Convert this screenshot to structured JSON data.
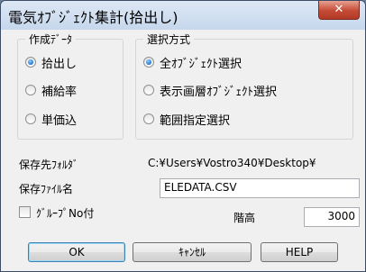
{
  "window": {
    "title": "電気ｵﾌﾞｼﾞｪｸﾄ集計(拾出し)",
    "close_symbol": "✕"
  },
  "data_group": {
    "legend": "作成ﾃﾞｰﾀ",
    "options": [
      {
        "label": "拾出し",
        "selected": true
      },
      {
        "label": "補給率",
        "selected": false
      },
      {
        "label": "単価込",
        "selected": false
      }
    ]
  },
  "method_group": {
    "legend": "選択方式",
    "options": [
      {
        "label": "全ｵﾌﾞｼﾞｪｸﾄ選択",
        "selected": true
      },
      {
        "label": "表示画層ｵﾌﾞｼﾞｪｸﾄ選択",
        "selected": false
      },
      {
        "label": "範囲指定選択",
        "selected": false
      }
    ]
  },
  "save_folder": {
    "label": "保存先ﾌｫﾙﾀﾞ",
    "value": "C:¥Users¥Vostro340¥Desktop¥"
  },
  "save_file": {
    "label": "保存ﾌｧｲﾙ名",
    "value": "ELEDATA.CSV"
  },
  "group_no": {
    "label": "ｸﾞﾙｰﾌﾟNo付",
    "checked": false
  },
  "floor_height": {
    "label": "階高",
    "value": "3000"
  },
  "buttons": {
    "ok": "OK",
    "cancel": "ｷｬﾝｾﾙ",
    "help": "HELP"
  }
}
